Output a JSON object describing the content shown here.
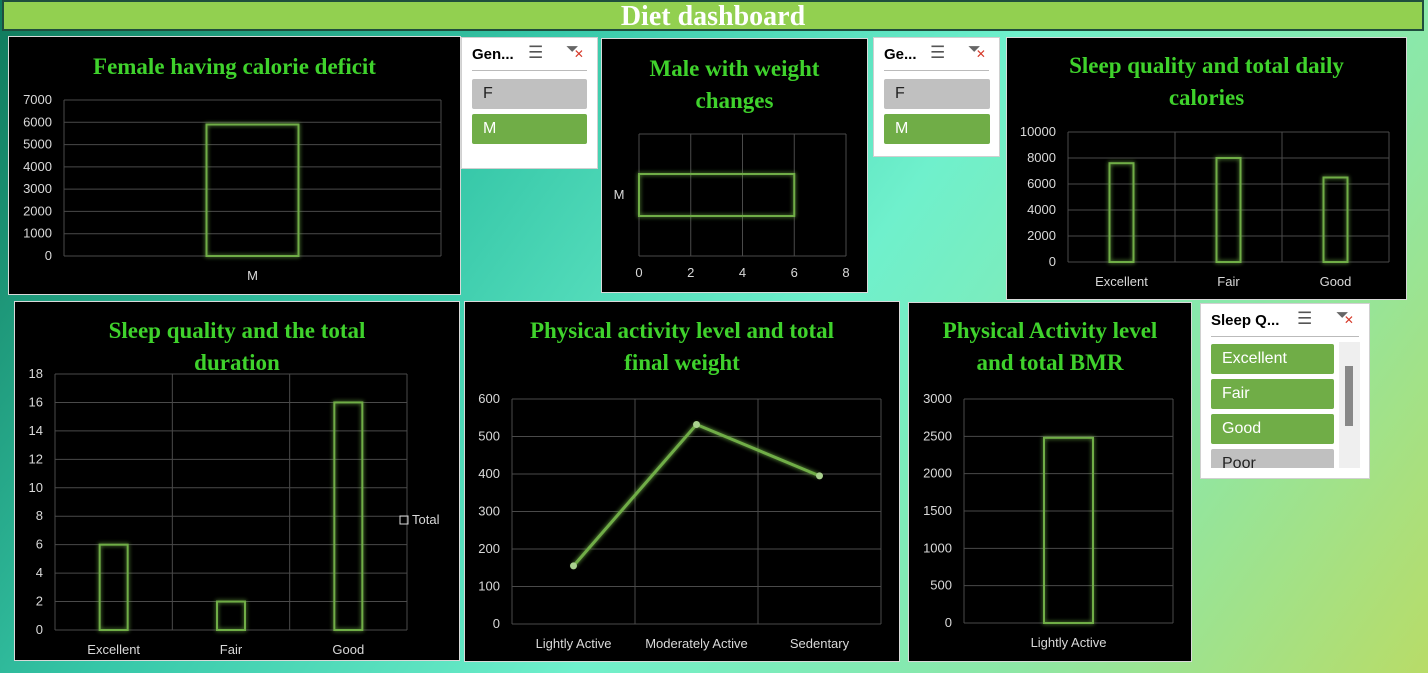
{
  "dashboard_title": "Diet dashboard",
  "slicers": {
    "gender1": {
      "header": "Gen...",
      "items": [
        {
          "label": "F",
          "selected": false
        },
        {
          "label": "M",
          "selected": true
        }
      ]
    },
    "gender2": {
      "header": "Ge...",
      "items": [
        {
          "label": "F",
          "selected": false
        },
        {
          "label": "M",
          "selected": true
        }
      ]
    },
    "sleep": {
      "header": "Sleep Q...",
      "items": [
        {
          "label": "Excellent",
          "selected": true
        },
        {
          "label": "Fair",
          "selected": true
        },
        {
          "label": "Good",
          "selected": true
        },
        {
          "label": "Poor",
          "selected": false
        }
      ]
    },
    "icons": {
      "multiselect": "multi-select-icon",
      "clear": "clear-filter-icon"
    }
  },
  "colors": {
    "title_green": "#3fd22c",
    "bar_green": "#70ad47",
    "header_bg": "#92d050"
  },
  "chart_data": [
    {
      "id": "female_deficit",
      "type": "bar",
      "title": "Female having calorie deficit",
      "categories": [
        "M"
      ],
      "values": [
        5900
      ],
      "ylim": [
        0,
        7000
      ],
      "yticks": [
        0,
        1000,
        2000,
        3000,
        4000,
        5000,
        6000,
        7000
      ],
      "grid": true
    },
    {
      "id": "male_weight",
      "type": "bar",
      "orientation": "horizontal",
      "title": "Male with weight changes",
      "categories": [
        "M"
      ],
      "values": [
        6
      ],
      "xlim": [
        0,
        8
      ],
      "xticks": [
        0,
        2,
        4,
        6,
        8
      ],
      "grid": true
    },
    {
      "id": "sleep_calories",
      "type": "bar",
      "title": "Sleep quality and total daily calories",
      "categories": [
        "Excellent",
        "Fair",
        "Good"
      ],
      "values": [
        7600,
        8000,
        6500
      ],
      "ylim": [
        0,
        10000
      ],
      "yticks": [
        0,
        2000,
        4000,
        6000,
        8000,
        10000
      ],
      "grid": true
    },
    {
      "id": "sleep_duration",
      "type": "bar",
      "title": "Sleep quality and the total duration",
      "categories": [
        "Excellent",
        "Fair",
        "Good"
      ],
      "values": [
        6,
        2,
        16
      ],
      "ylim": [
        0,
        18
      ],
      "yticks": [
        0,
        2,
        4,
        6,
        8,
        10,
        12,
        14,
        16,
        18
      ],
      "grid": true,
      "legend": "Total"
    },
    {
      "id": "activity_weight",
      "type": "line",
      "title": "Physical activity level and total final weight",
      "categories": [
        "Lightly Active",
        "Moderately Active",
        "Sedentary"
      ],
      "values": [
        155,
        532,
        395
      ],
      "ylim": [
        0,
        600
      ],
      "yticks": [
        0,
        100,
        200,
        300,
        400,
        500,
        600
      ],
      "grid": true
    },
    {
      "id": "activity_bmr",
      "type": "bar",
      "title": "Physical Activity level and total BMR",
      "categories": [
        "Lightly Active"
      ],
      "values": [
        2480
      ],
      "ylim": [
        0,
        3000
      ],
      "yticks": [
        0,
        500,
        1000,
        1500,
        2000,
        2500,
        3000
      ],
      "grid": true
    }
  ]
}
